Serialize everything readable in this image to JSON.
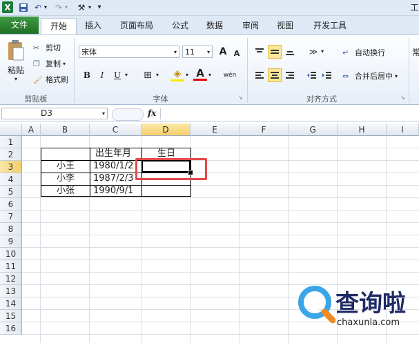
{
  "qat": {
    "app_icon": "X",
    "undo_icon": "↶",
    "redo_icon": "↷",
    "custom_icon": "⚒",
    "more": "▾",
    "right_label": "工"
  },
  "tabs": [
    "文件",
    "开始",
    "插入",
    "页面布局",
    "公式",
    "数据",
    "审阅",
    "视图",
    "开发工具"
  ],
  "clipboard": {
    "paste": "粘贴",
    "cut": "剪切",
    "copy": "复制",
    "format_painter": "格式刷",
    "group": "剪贴板"
  },
  "font": {
    "name": "宋体",
    "size": "11",
    "bold": "B",
    "italic": "I",
    "underline": "U",
    "grow": "A",
    "shrink": "A",
    "group": "字体",
    "border": "⊞",
    "fill": "◈",
    "color": "A",
    "phonetic": "wén"
  },
  "alignment": {
    "wrap": "自动换行",
    "merge": "合并后居中",
    "group": "对齐方式"
  },
  "right_cut": "常",
  "formula_bar": {
    "name_box": "D3",
    "fx": "fx",
    "value": ""
  },
  "columns": [
    "A",
    "B",
    "C",
    "D",
    "E",
    "F",
    "G",
    "H",
    "I"
  ],
  "rows": [
    "1",
    "2",
    "3",
    "4",
    "5",
    "6",
    "7",
    "8",
    "9",
    "10",
    "11",
    "12",
    "13",
    "14",
    "15",
    "16"
  ],
  "table": {
    "header": {
      "c": "出生年月",
      "d": "生日"
    },
    "rows": [
      {
        "b": "小王",
        "c": "1980/1/2",
        "d": ""
      },
      {
        "b": "小李",
        "c": "1987/2/3",
        "d": ""
      },
      {
        "b": "小张",
        "c": "1990/9/1",
        "d": ""
      }
    ]
  },
  "watermark": {
    "cn": "查询啦",
    "url": "chaxunla.com"
  },
  "colors": {
    "accent_red": "#e24b4b",
    "file_tab": "#2e7d32",
    "ribbon": "#dfe9f5"
  }
}
